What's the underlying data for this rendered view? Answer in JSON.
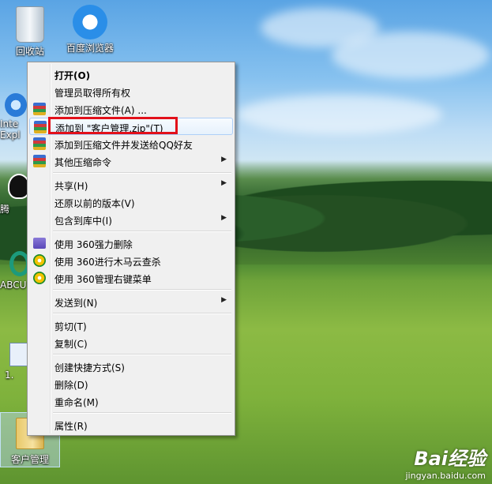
{
  "desktop": {
    "icons": [
      {
        "label": "回收站",
        "icon": "recycle-bin-icon"
      },
      {
        "label": "百度浏览器",
        "icon": "baidu-browser-icon"
      },
      {
        "label": "Inte Expl",
        "icon": "ie-icon"
      },
      {
        "label": "腾",
        "icon": "qq-icon"
      },
      {
        "label": "ABCU",
        "icon": "abc-icon"
      },
      {
        "label": "1.",
        "icon": "file-icon"
      },
      {
        "label": "客户管理",
        "icon": "folder-icon"
      }
    ]
  },
  "context_menu": {
    "groups": [
      [
        {
          "label": "打开(O)",
          "bold": true,
          "icon": "",
          "submenu": false
        },
        {
          "label": "管理员取得所有权",
          "icon": "",
          "submenu": false
        },
        {
          "label": "添加到压缩文件(A) ...",
          "icon": "winrar-icon",
          "submenu": false
        },
        {
          "label": "添加到 \"客户管理.zip\"(T)",
          "icon": "winrar-icon",
          "submenu": false,
          "highlighted": true
        },
        {
          "label": "添加到压缩文件并发送给QQ好友",
          "icon": "winrar-icon",
          "submenu": false
        },
        {
          "label": "其他压缩命令",
          "icon": "winrar-icon",
          "submenu": true
        }
      ],
      [
        {
          "label": "共享(H)",
          "icon": "",
          "submenu": true
        },
        {
          "label": "还原以前的版本(V)",
          "icon": "",
          "submenu": false
        },
        {
          "label": "包含到库中(I)",
          "icon": "",
          "submenu": true
        }
      ],
      [
        {
          "label": "使用 360强力删除",
          "icon": "shredder-icon",
          "submenu": false
        },
        {
          "label": "使用 360进行木马云查杀",
          "icon": "360-icon",
          "submenu": false
        },
        {
          "label": "使用 360管理右键菜单",
          "icon": "360-icon",
          "submenu": false
        }
      ],
      [
        {
          "label": "发送到(N)",
          "icon": "",
          "submenu": true
        }
      ],
      [
        {
          "label": "剪切(T)",
          "icon": "",
          "submenu": false
        },
        {
          "label": "复制(C)",
          "icon": "",
          "submenu": false
        }
      ],
      [
        {
          "label": "创建快捷方式(S)",
          "icon": "",
          "submenu": false
        },
        {
          "label": "删除(D)",
          "icon": "",
          "submenu": false
        },
        {
          "label": "重命名(M)",
          "icon": "",
          "submenu": false
        }
      ],
      [
        {
          "label": "属性(R)",
          "icon": "",
          "submenu": false
        }
      ]
    ]
  },
  "watermark": {
    "brand": "Bai经验",
    "url": "jingyan.baidu.com"
  },
  "colors": {
    "highlight_box": "#e2101a",
    "menu_bg": "#f0f0f0"
  }
}
